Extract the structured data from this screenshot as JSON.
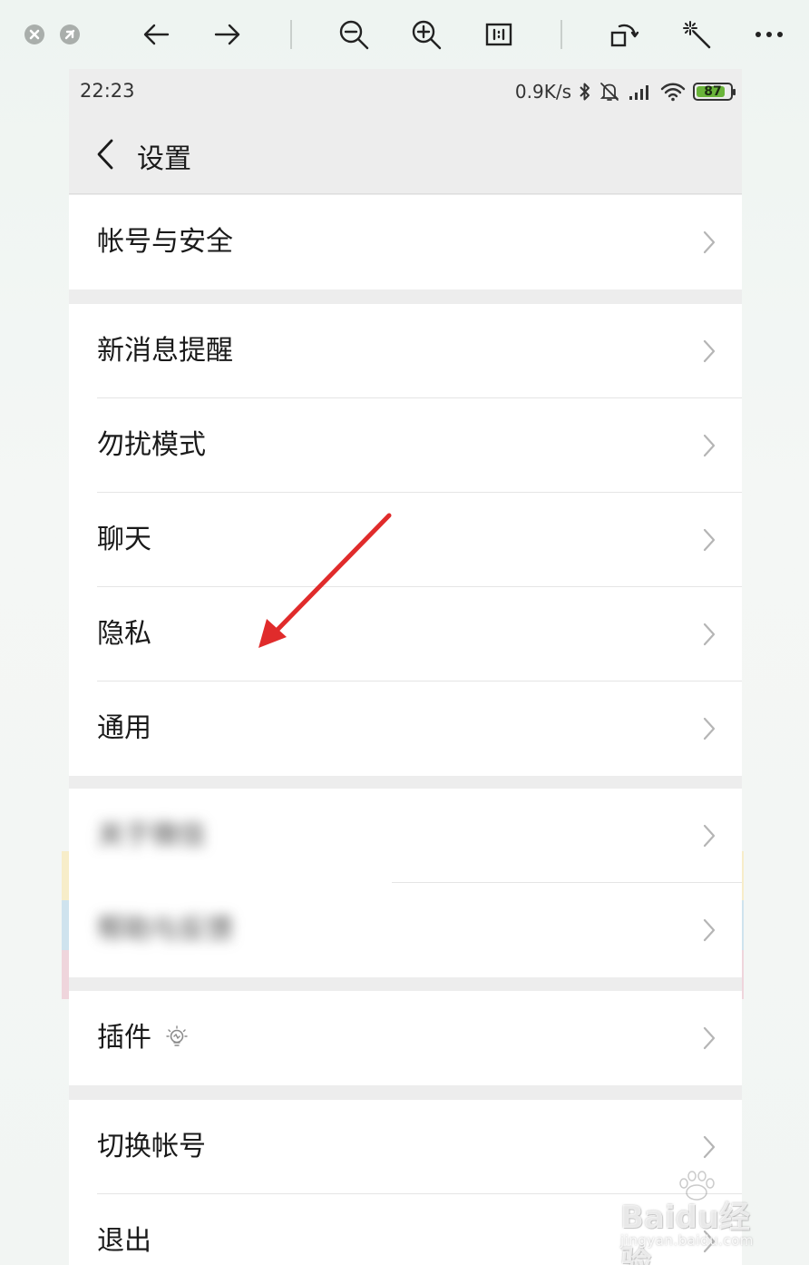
{
  "viewer_toolbar": {
    "icons": [
      "close-icon",
      "minimize-icon",
      "arrow-left-icon",
      "arrow-right-icon",
      "zoom-out-icon",
      "zoom-in-icon",
      "actual-size-icon",
      "rotate-icon",
      "magic-wand-icon",
      "more-icon"
    ]
  },
  "status_bar": {
    "time": "22:23",
    "speed": "0.9K/s",
    "battery": "87",
    "battery_level_percent": 87,
    "icons": [
      "bluetooth-icon",
      "mute-icon",
      "signal-icon",
      "wifi-icon",
      "battery-icon"
    ]
  },
  "nav": {
    "title": "设置"
  },
  "groups": [
    {
      "items": [
        {
          "label": "帐号与安全"
        }
      ]
    },
    {
      "items": [
        {
          "label": "新消息提醒"
        },
        {
          "label": "勿扰模式"
        },
        {
          "label": "聊天"
        },
        {
          "label": "隐私"
        },
        {
          "label": "通用"
        }
      ]
    },
    {
      "items": [
        {
          "label": "关于微信"
        },
        {
          "label": "帮助与反馈"
        }
      ]
    },
    {
      "items": [
        {
          "label": "插件"
        }
      ]
    },
    {
      "items": [
        {
          "label": "切换帐号"
        },
        {
          "label": "退出"
        }
      ]
    }
  ],
  "colors": {
    "annotation_arrow": "#e02b2b",
    "battery_fill": "#6ab43a",
    "page_bg": "#ededed"
  },
  "watermark": {
    "title": "Baidu经验",
    "subtitle": "jingyan.baidu.com"
  }
}
